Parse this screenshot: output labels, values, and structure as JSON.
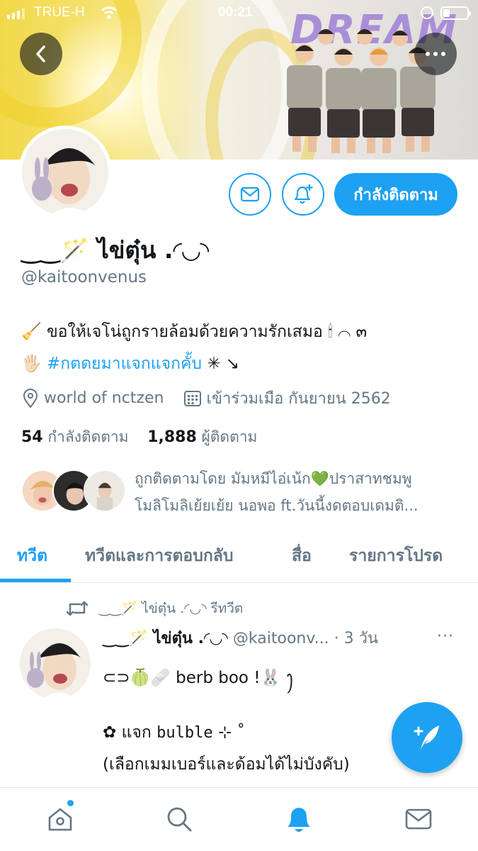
{
  "status_bar": {
    "carrier": "TRUE-H",
    "time": "00:21"
  },
  "banner": {
    "title": "DREAM"
  },
  "profile": {
    "display_name": "‿‿🪄 ไข่ตุ๋น .◜◡◝",
    "handle": "@kaitoonvenus",
    "bio_line1": "🧹 ขอให้เจโน่ถูกรายล้อมด้วยความรักเสมอ 🕯 ⌒ ๓",
    "bio_line2_prefix": "🖐🏻 ",
    "bio_hashtag": "#กตดยมาแจกแจกคั้บ",
    "bio_line2_suffix": " ✳ ↘",
    "location": "world of nctzen",
    "joined": "เข้าร่วมเมือ กันยายน 2562",
    "following_count": "54",
    "following_label": "กำลังติดตาม",
    "followers_count": "1,888",
    "followers_label": "ผู้ติดตาม",
    "followed_by_line1": "ถูกติดตามโดย มัมหมีไอ่เน้ก💚ปราสาทชมพู",
    "followed_by_line2": "โมลิโมลิเย้ยเย้ย นอพอ ft.วันนี้งดตอบเดมติ..."
  },
  "buttons": {
    "follow_label": "กำลังติดตาม"
  },
  "tabs": [
    {
      "label": "ทวีต",
      "active": true
    },
    {
      "label": "ทวีตและการตอบกลับ",
      "active": false
    },
    {
      "label": "สื่อ",
      "active": false
    },
    {
      "label": "รายการโปรด",
      "active": false
    }
  ],
  "tweet": {
    "retweet_text": "‿‿🪄 ไข่ตุ๋น .◜◡◝  รีทวีต",
    "author_name": "‿‿🪄 ไข่ตุ๋น .◜◡◝",
    "author_handle": "@kaitoonv...",
    "time": "· 3 วัน",
    "more": "···",
    "line1": "⊂⊃🍈🩹 berb boo !🐰 ꫂ",
    "line2_prefix": "✿ แจก ",
    "line2_mono": "bulble",
    "line2_suffix": " ⊹ ˚",
    "line3": "(เลือกเมมเบอร์และด้อมได้ไม่บังคับ)"
  },
  "colors": {
    "accent": "#1da1f2",
    "secondary_text": "#657786"
  },
  "icons": {
    "back": "chevron-left-icon",
    "more": "ellipsis-icon",
    "mail": "envelope-icon",
    "bell": "bell-plus-icon",
    "location": "location-pin-icon",
    "calendar": "calendar-icon",
    "retweet": "retweet-icon",
    "compose": "feather-plus-icon",
    "nav": [
      "home-icon",
      "search-icon",
      "bell-icon",
      "mail-icon"
    ]
  }
}
